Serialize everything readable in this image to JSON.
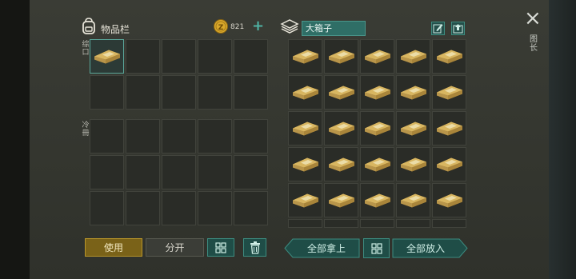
{
  "inventory": {
    "title": "物品栏",
    "coins": "821",
    "plus": "+",
    "section_top_label": "综口",
    "section_bottom_label": "冷冊",
    "top_rows": 2,
    "bottom_rows": 3,
    "columns": 5,
    "top_items": [
      {
        "slot": 0,
        "item": "gold-bar"
      }
    ]
  },
  "chest": {
    "name": "大箱子",
    "rows": 5,
    "columns": 5,
    "item": "gold-bar",
    "filled_slots": 25
  },
  "actions": {
    "use": "使用",
    "split": "分开",
    "take_all": "全部拿上",
    "put_all": "全部放入"
  },
  "side": {
    "close": "×",
    "label": "图长"
  },
  "colors": {
    "accent_teal": "#2f6e66",
    "use_gold": "#7a6218",
    "coin": "#d9a82b",
    "gold_bar": "#c9a451"
  }
}
